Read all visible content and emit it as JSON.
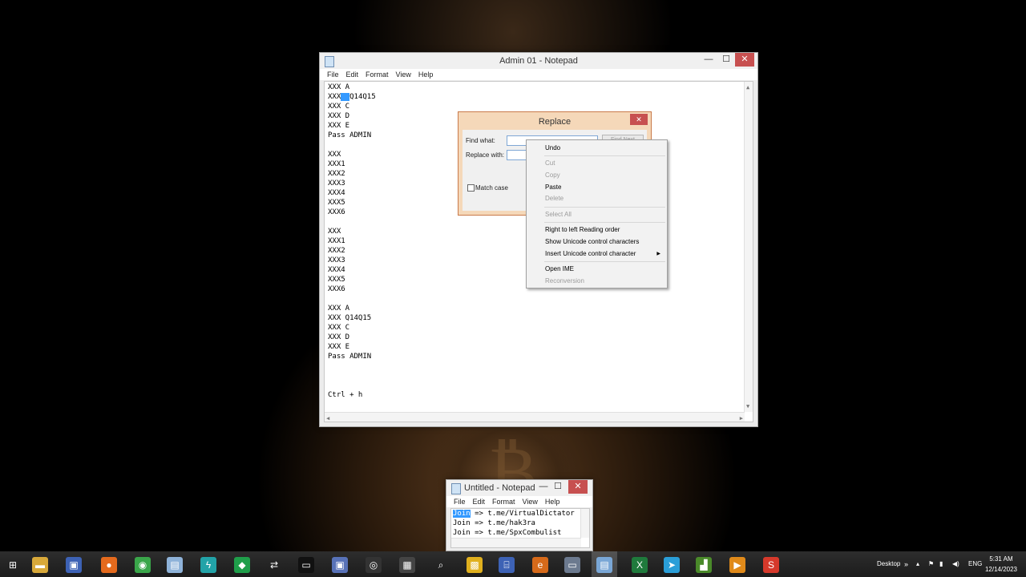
{
  "main_window": {
    "title": "Admin 01 - Notepad",
    "menu": [
      "File",
      "Edit",
      "Format",
      "View",
      "Help"
    ],
    "lines": [
      "XXX A",
      "XXX Q14Q15",
      "XXX C",
      "XXX D",
      "XXX E",
      "Pass ADMIN",
      "",
      "XXX",
      "XXX1",
      "XXX2",
      "XXX3",
      "XXX4",
      "XXX5",
      "XXX6",
      "",
      "XXX",
      "XXX1",
      "XXX2",
      "XXX3",
      "XXX4",
      "XXX5",
      "XXX6",
      "",
      "XXX A",
      "XXX Q14Q15",
      "XXX C",
      "XXX D",
      "XXX E",
      "Pass ADMIN",
      "",
      "",
      "",
      "Ctrl + h"
    ]
  },
  "replace_dialog": {
    "title": "Replace",
    "find_label": "Find what:",
    "replace_label": "Replace with:",
    "find_next_label": "Find Next",
    "match_case_label": "Match case",
    "find_value": "",
    "replace_value": ""
  },
  "context_menu": {
    "items": [
      {
        "label": "Undo",
        "enabled": true
      },
      {
        "label": "Cut",
        "enabled": false
      },
      {
        "label": "Copy",
        "enabled": false
      },
      {
        "label": "Paste",
        "enabled": true
      },
      {
        "label": "Delete",
        "enabled": false
      },
      {
        "label": "Select All",
        "enabled": false
      },
      {
        "label": "Right to left Reading order",
        "enabled": true
      },
      {
        "label": "Show Unicode control characters",
        "enabled": true
      },
      {
        "label": "Insert Unicode control character",
        "enabled": true
      },
      {
        "label": "Open IME",
        "enabled": true
      },
      {
        "label": "Reconversion",
        "enabled": false
      }
    ]
  },
  "second_window": {
    "title": "Untitled - Notepad",
    "menu": [
      "File",
      "Edit",
      "Format",
      "View",
      "Help"
    ],
    "lines": [
      {
        "prefix": "Join",
        "rest": " => t.me/VirtualDictator"
      },
      {
        "prefix": "Join",
        "rest": " => t.me/hak3ra"
      },
      {
        "prefix": "Join",
        "rest": " => t.me/SpxCombulist"
      }
    ]
  },
  "taskbar": {
    "desktop_label": "Desktop",
    "language": "ENG",
    "time": "5:31 AM",
    "date": "12/14/2023",
    "icons": [
      "windows-start-icon",
      "file-explorer-icon",
      "network-tool-icon",
      "firefox-icon",
      "chrome-icon",
      "notepad-icon",
      "lightning-app-icon",
      "diamond-app-icon",
      "transfer-icon",
      "terminal-icon",
      "remote-icon",
      "nox-icon",
      "media-clapper-icon",
      "search-magnifier-icon",
      "calculator-icon",
      "network-computers-icon",
      "edge-icon",
      "computer-icon",
      "notepad-active-icon",
      "excel-icon",
      "telegram-icon",
      "chart-app-icon",
      "media-player-icon",
      "s-app-icon"
    ]
  }
}
